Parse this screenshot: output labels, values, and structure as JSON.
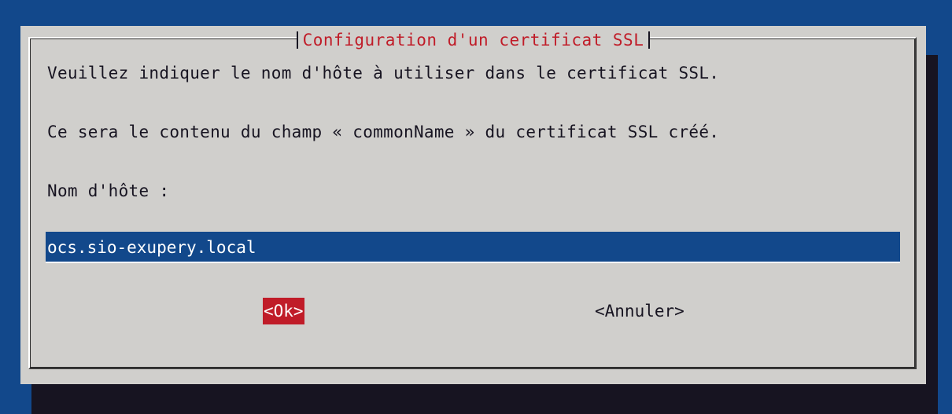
{
  "dialog": {
    "title": "Configuration d'un certificat SSL",
    "line1": "Veuillez indiquer le nom d'hôte à utiliser dans le certificat SSL.",
    "line2": "Ce sera le contenu du champ « commonName » du certificat SSL créé.",
    "field_label": "Nom d'hôte :",
    "hostname_value": "ocs.sio-exupery.local",
    "ok_label": "<Ok>",
    "cancel_label": "<Annuler>"
  },
  "colors": {
    "background": "#12488b",
    "dialog": "#d0cfcc",
    "title": "#c01c28",
    "selected_button": "#c01c28",
    "text": "#171421",
    "input_bg": "#12488b"
  }
}
